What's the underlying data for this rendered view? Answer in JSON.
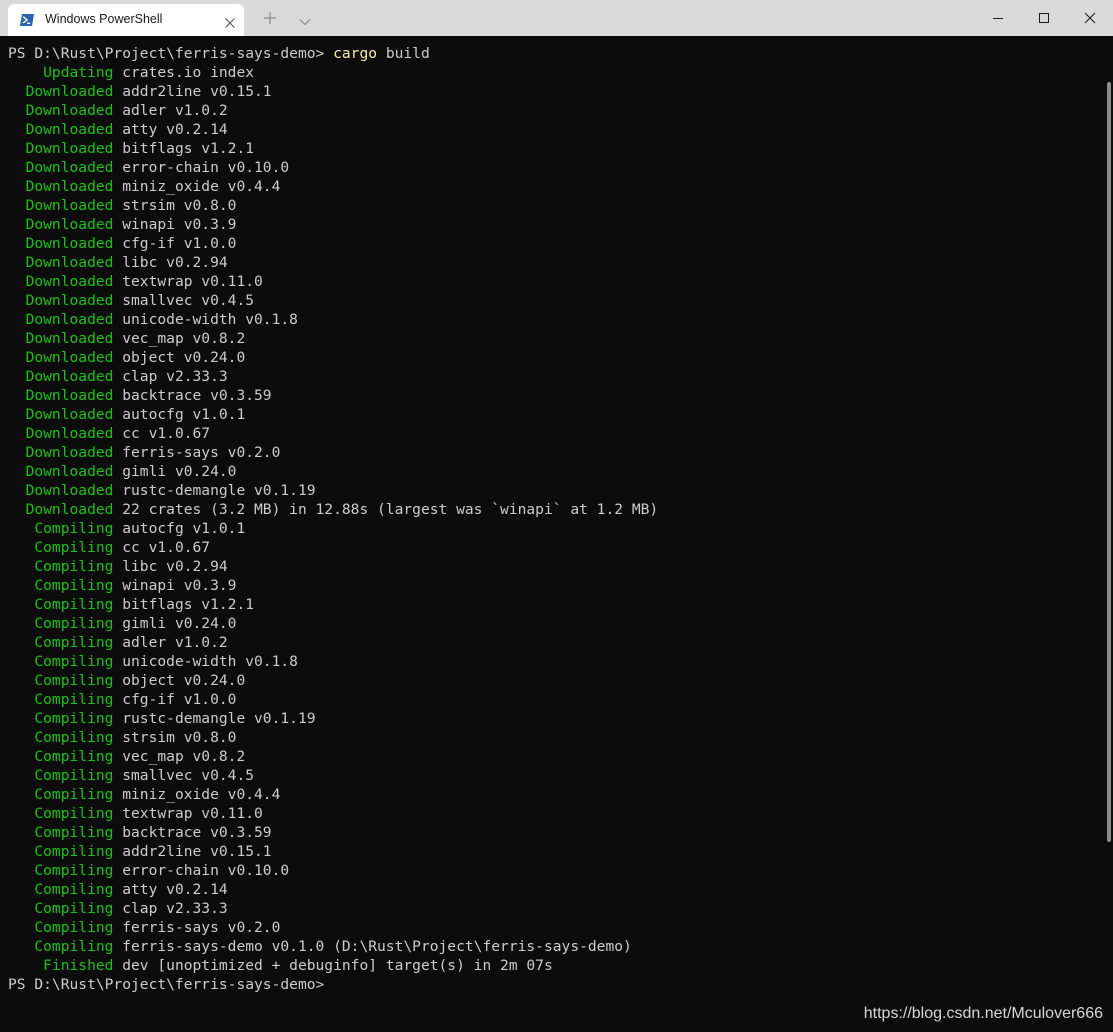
{
  "window": {
    "tab_title": "Windows PowerShell",
    "tab_icon": "powershell-icon",
    "close_tab_icon": "close-icon",
    "new_tab_icon": "plus-icon",
    "dropdown_icon": "chevron-down-icon",
    "minimize_icon": "minimize-icon",
    "maximize_icon": "maximize-icon",
    "close_icon": "close-icon"
  },
  "colors": {
    "terminal_bg": "#0c0c0c",
    "text": "#cccccc",
    "status_green": "#16c60c",
    "command_yellow": "#f9f1a5",
    "titlebar_bg": "#d9d9d9"
  },
  "terminal": {
    "lines": [
      {
        "pre": "PS D:\\Rust\\Project\\ferris-says-demo> ",
        "cmd": "cargo",
        "rest": " build"
      },
      {
        "label": "    Updating",
        "rest": " crates.io index"
      },
      {
        "label": "  Downloaded",
        "rest": " addr2line v0.15.1"
      },
      {
        "label": "  Downloaded",
        "rest": " adler v1.0.2"
      },
      {
        "label": "  Downloaded",
        "rest": " atty v0.2.14"
      },
      {
        "label": "  Downloaded",
        "rest": " bitflags v1.2.1"
      },
      {
        "label": "  Downloaded",
        "rest": " error-chain v0.10.0"
      },
      {
        "label": "  Downloaded",
        "rest": " miniz_oxide v0.4.4"
      },
      {
        "label": "  Downloaded",
        "rest": " strsim v0.8.0"
      },
      {
        "label": "  Downloaded",
        "rest": " winapi v0.3.9"
      },
      {
        "label": "  Downloaded",
        "rest": " cfg-if v1.0.0"
      },
      {
        "label": "  Downloaded",
        "rest": " libc v0.2.94"
      },
      {
        "label": "  Downloaded",
        "rest": " textwrap v0.11.0"
      },
      {
        "label": "  Downloaded",
        "rest": " smallvec v0.4.5"
      },
      {
        "label": "  Downloaded",
        "rest": " unicode-width v0.1.8"
      },
      {
        "label": "  Downloaded",
        "rest": " vec_map v0.8.2"
      },
      {
        "label": "  Downloaded",
        "rest": " object v0.24.0"
      },
      {
        "label": "  Downloaded",
        "rest": " clap v2.33.3"
      },
      {
        "label": "  Downloaded",
        "rest": " backtrace v0.3.59"
      },
      {
        "label": "  Downloaded",
        "rest": " autocfg v1.0.1"
      },
      {
        "label": "  Downloaded",
        "rest": " cc v1.0.67"
      },
      {
        "label": "  Downloaded",
        "rest": " ferris-says v0.2.0"
      },
      {
        "label": "  Downloaded",
        "rest": " gimli v0.24.0"
      },
      {
        "label": "  Downloaded",
        "rest": " rustc-demangle v0.1.19"
      },
      {
        "label": "  Downloaded",
        "rest": " 22 crates (3.2 MB) in 12.88s (largest was `winapi` at 1.2 MB)"
      },
      {
        "label": "   Compiling",
        "rest": " autocfg v1.0.1"
      },
      {
        "label": "   Compiling",
        "rest": " cc v1.0.67"
      },
      {
        "label": "   Compiling",
        "rest": " libc v0.2.94"
      },
      {
        "label": "   Compiling",
        "rest": " winapi v0.3.9"
      },
      {
        "label": "   Compiling",
        "rest": " bitflags v1.2.1"
      },
      {
        "label": "   Compiling",
        "rest": " gimli v0.24.0"
      },
      {
        "label": "   Compiling",
        "rest": " adler v1.0.2"
      },
      {
        "label": "   Compiling",
        "rest": " unicode-width v0.1.8"
      },
      {
        "label": "   Compiling",
        "rest": " object v0.24.0"
      },
      {
        "label": "   Compiling",
        "rest": " cfg-if v1.0.0"
      },
      {
        "label": "   Compiling",
        "rest": " rustc-demangle v0.1.19"
      },
      {
        "label": "   Compiling",
        "rest": " strsim v0.8.0"
      },
      {
        "label": "   Compiling",
        "rest": " vec_map v0.8.2"
      },
      {
        "label": "   Compiling",
        "rest": " smallvec v0.4.5"
      },
      {
        "label": "   Compiling",
        "rest": " miniz_oxide v0.4.4"
      },
      {
        "label": "   Compiling",
        "rest": " textwrap v0.11.0"
      },
      {
        "label": "   Compiling",
        "rest": " backtrace v0.3.59"
      },
      {
        "label": "   Compiling",
        "rest": " addr2line v0.15.1"
      },
      {
        "label": "   Compiling",
        "rest": " error-chain v0.10.0"
      },
      {
        "label": "   Compiling",
        "rest": " atty v0.2.14"
      },
      {
        "label": "   Compiling",
        "rest": " clap v2.33.3"
      },
      {
        "label": "   Compiling",
        "rest": " ferris-says v0.2.0"
      },
      {
        "label": "   Compiling",
        "rest": " ferris-says-demo v0.1.0 (D:\\Rust\\Project\\ferris-says-demo)"
      },
      {
        "label": "    Finished",
        "rest": " dev [unoptimized + debuginfo] target(s) in 2m 07s"
      },
      {
        "pre": "PS D:\\Rust\\Project\\ferris-says-demo>"
      }
    ]
  },
  "watermark": "https://blog.csdn.net/Mculover666"
}
